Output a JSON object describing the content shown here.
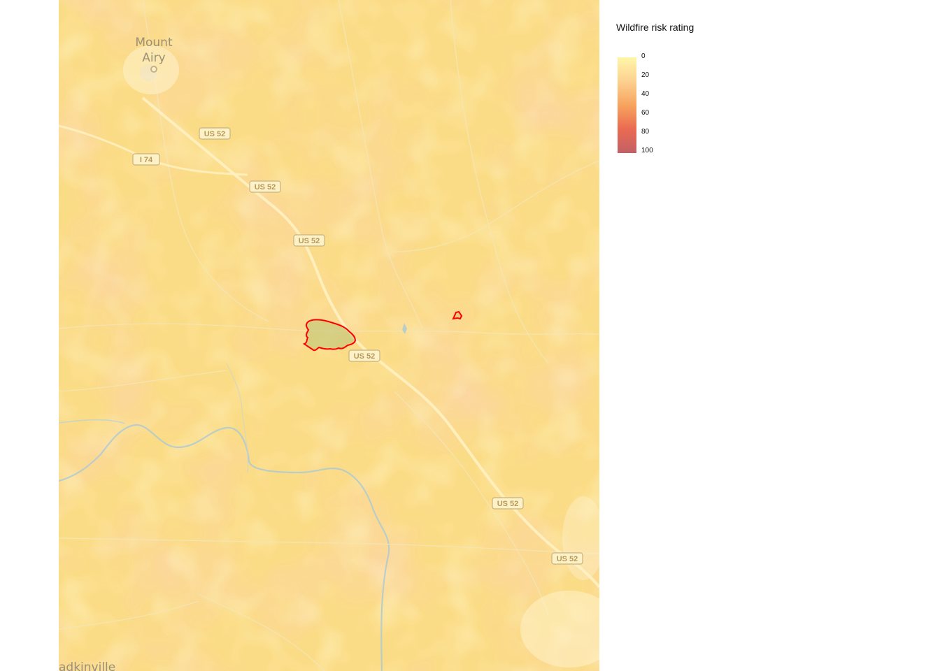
{
  "legend": {
    "title": "Wildfire risk rating",
    "ticks": [
      "0",
      "20",
      "40",
      "60",
      "80",
      "100"
    ],
    "colors": [
      "#fff6a8",
      "#fcd190",
      "#f7a45e",
      "#ea6a52",
      "#c26066"
    ]
  },
  "map": {
    "places": [
      "Mount",
      "Airy",
      "adkinville"
    ],
    "route_shields": [
      "US 52",
      "I 74",
      "US 52",
      "US 52",
      "US 52",
      "US 52",
      "US 52"
    ],
    "boundary_color": "#ff0000"
  }
}
